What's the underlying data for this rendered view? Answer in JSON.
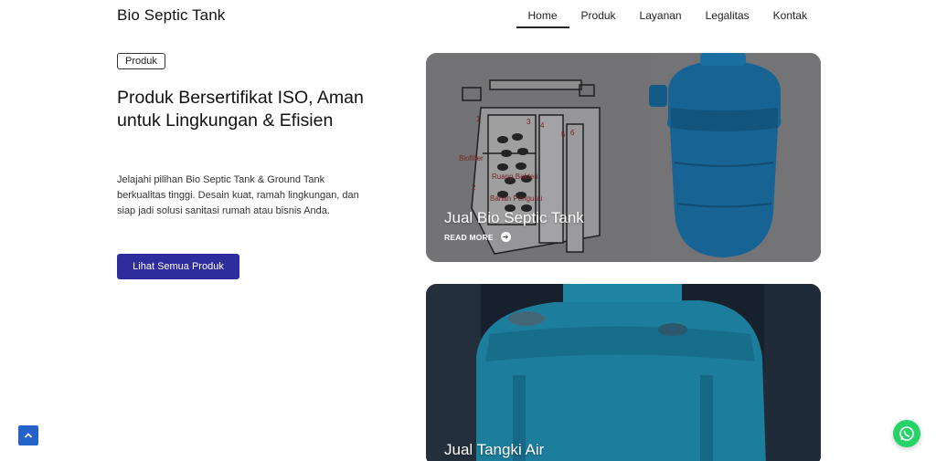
{
  "header": {
    "brand": "Bio Septic Tank",
    "nav": [
      {
        "label": "Home",
        "active": true
      },
      {
        "label": "Produk",
        "active": false
      },
      {
        "label": "Layanan",
        "active": false
      },
      {
        "label": "Legalitas",
        "active": false
      },
      {
        "label": "Kontak",
        "active": false
      }
    ]
  },
  "hero": {
    "badge": "Produk",
    "headline": "Produk Bersertifikat ISO, Aman untuk Lingkungan & Efisien",
    "description": "Jelajahi pilihan Bio Septic Tank & Ground Tank berkualitas tinggi. Desain kuat, ramah lingkungan, dan siap jadi solusi sanitasi rumah atau bisnis Anda.",
    "cta_label": "Lihat Semua Produk"
  },
  "cards": [
    {
      "title": "Jual Bio Septic Tank",
      "read_more": "READ MORE"
    },
    {
      "title": "Jual Tangki Air"
    }
  ],
  "diagram": {
    "labels": [
      "1",
      "2",
      "3",
      "4",
      "5",
      "6",
      "Biofilter",
      "Ruang Bakteri",
      "Bahan Pengurai"
    ]
  },
  "colors": {
    "accent": "#2f2c9e",
    "tank_blue": "#1f86c6",
    "whatsapp": "#25d366",
    "scroll_top": "#2463c9"
  },
  "icons": {
    "read_more": "arrow-circle-right-icon",
    "scroll_top": "chevron-up-icon",
    "whatsapp": "whatsapp-icon"
  }
}
